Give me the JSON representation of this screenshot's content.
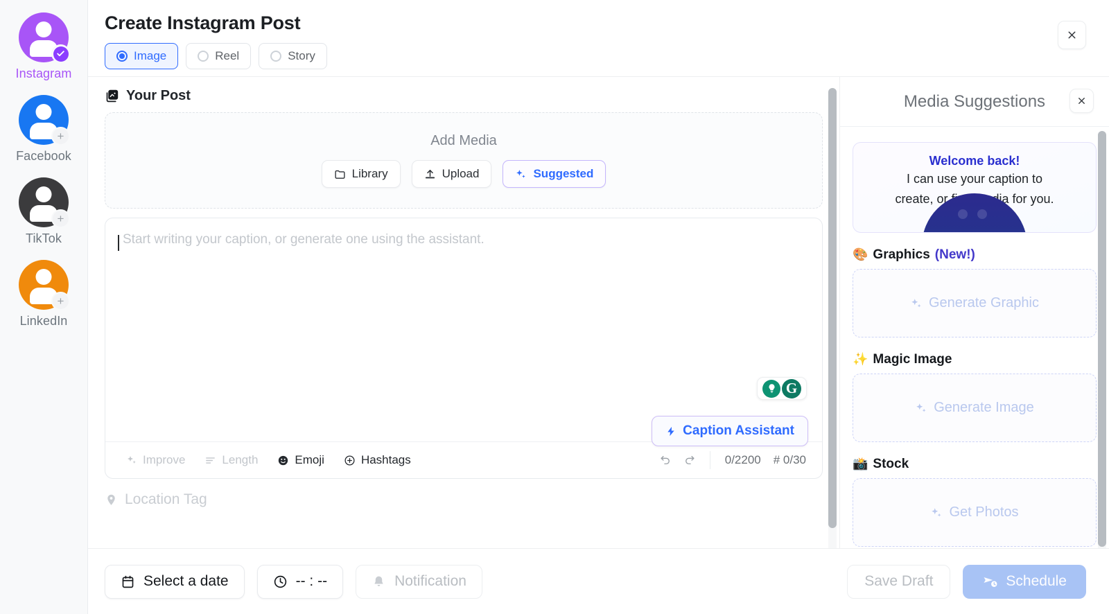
{
  "accounts": [
    {
      "name": "Instagram",
      "state": "connected",
      "badge": "check-badge",
      "color": "#a855f7",
      "label_color": "#a855f7"
    },
    {
      "name": "Facebook",
      "state": "add",
      "badge": "plus-badge",
      "color": "#1877f2",
      "label_color": "#6c757d"
    },
    {
      "name": "TikTok",
      "state": "add",
      "badge": "plus-badge",
      "color": "#3b3b3d",
      "label_color": "#6c757d"
    },
    {
      "name": "LinkedIn",
      "state": "add",
      "badge": "plus-badge",
      "color": "#f08a0c",
      "label_color": "#6c757d"
    }
  ],
  "header": {
    "title": "Create Instagram Post",
    "close_icon": "close-icon",
    "post_types": [
      {
        "label": "Image",
        "selected": true
      },
      {
        "label": "Reel",
        "selected": false
      },
      {
        "label": "Story",
        "selected": false
      }
    ]
  },
  "editor": {
    "section_label": "Your Post",
    "section_icon": "image-stack-icon",
    "media": {
      "title": "Add Media",
      "buttons": [
        {
          "label": "Library",
          "icon": "folder-icon"
        },
        {
          "label": "Upload",
          "icon": "upload-icon"
        },
        {
          "label": "Suggested",
          "icon": "sparkle-icon",
          "highlighted": true
        }
      ]
    },
    "caption": {
      "placeholder": "Start writing your caption, or generate one using the assistant.",
      "value": "",
      "assistant_button": "Caption Assistant",
      "assistant_icon": "bolt-icon",
      "grammarly": {
        "bulb_icon": "grammarly-bulb-icon",
        "logo_icon": "grammarly-g-icon"
      }
    },
    "toolbar": {
      "items": [
        {
          "label": "Improve",
          "icon": "sparkle-icon",
          "disabled": true
        },
        {
          "label": "Length",
          "icon": "lines-icon",
          "disabled": true
        },
        {
          "label": "Emoji",
          "icon": "emoji-icon",
          "disabled": false
        },
        {
          "label": "Hashtags",
          "icon": "plus-circle-icon",
          "disabled": false
        }
      ],
      "undo_icon": "undo-icon",
      "redo_icon": "redo-icon",
      "char_count": "0/2200",
      "hashtag_count": "# 0/30"
    },
    "location": {
      "label": "Location Tag",
      "icon": "map-pin-icon"
    }
  },
  "suggestions": {
    "title": "Media Suggestions",
    "close_icon": "close-icon",
    "welcome": {
      "heading": "Welcome back!",
      "line1": "I can use your caption to",
      "line2": "create, or find media for you.",
      "illustration": "robot-avatar"
    },
    "sections": [
      {
        "emoji": "🎨",
        "icon_name": "palette-icon",
        "title": "Graphics",
        "tag": "(New!)",
        "action": "Generate Graphic",
        "action_icon": "sparkle-icon"
      },
      {
        "emoji": "✨",
        "icon_name": "sparkles-icon",
        "title": "Magic Image",
        "tag": "",
        "action": "Generate Image",
        "action_icon": "sparkle-icon"
      },
      {
        "emoji": "📸",
        "icon_name": "camera-icon",
        "title": "Stock",
        "tag": "",
        "action": "Get Photos",
        "action_icon": "sparkle-icon"
      }
    ]
  },
  "footer": {
    "date_button": {
      "label": "Select a date",
      "icon": "calendar-icon"
    },
    "time_button": {
      "label": "-- : --",
      "icon": "clock-icon"
    },
    "notification_button": {
      "label": "Notification",
      "icon": "bell-icon"
    },
    "save_draft": "Save Draft",
    "schedule": "Schedule",
    "schedule_icon": "send-clock-icon"
  },
  "colors": {
    "accent_blue": "#2f6bff",
    "instagram_purple": "#a855f7",
    "facebook_blue": "#1877f2",
    "linkedin_orange": "#f08a0c",
    "grammarly_green": "#0d7a63",
    "new_tag": "#4338ca"
  }
}
